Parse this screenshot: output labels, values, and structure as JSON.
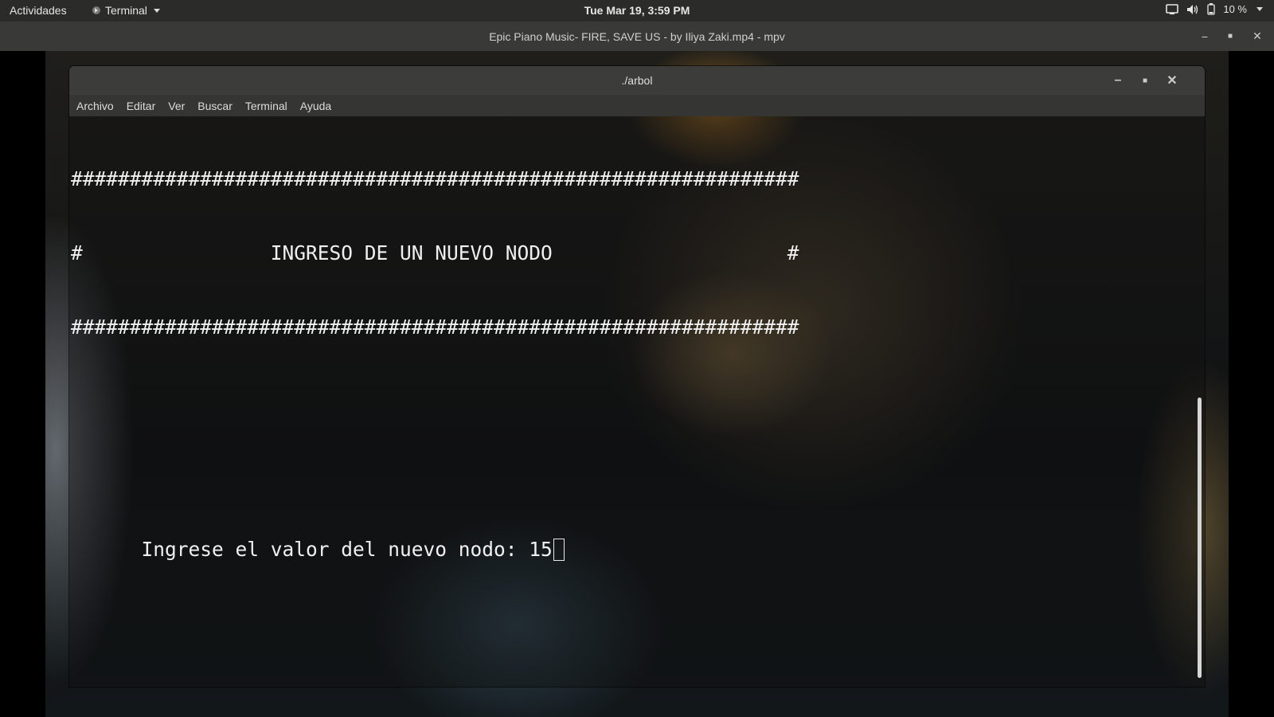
{
  "topbar": {
    "activities": "Actividades",
    "app_menu": "Terminal",
    "clock": "Tue Mar 19,  3:59 PM",
    "battery": "10 %"
  },
  "mpv": {
    "title": "Epic Piano Music- FIRE, SAVE US - by Iliya Zaki.mp4 - mpv"
  },
  "terminal": {
    "title": "./arbol",
    "menu": [
      "Archivo",
      "Editar",
      "Ver",
      "Buscar",
      "Terminal",
      "Ayuda"
    ],
    "lines": [
      "##############################################################",
      "#                INGRESO DE UN NUEVO NODO                    #",
      "##############################################################",
      "",
      "",
      "      Ingrese el valor del nuevo nodo: 15"
    ]
  },
  "colors": {
    "topbar_bg": "#2b2b29",
    "titlebar_bg": "#3c3d3a",
    "terminal_text": "#f0f0f0"
  },
  "icons": [
    "display-icon",
    "volume-icon",
    "battery-icon",
    "chevron-down-icon",
    "minimize-icon",
    "maximize-icon",
    "close-icon"
  ]
}
